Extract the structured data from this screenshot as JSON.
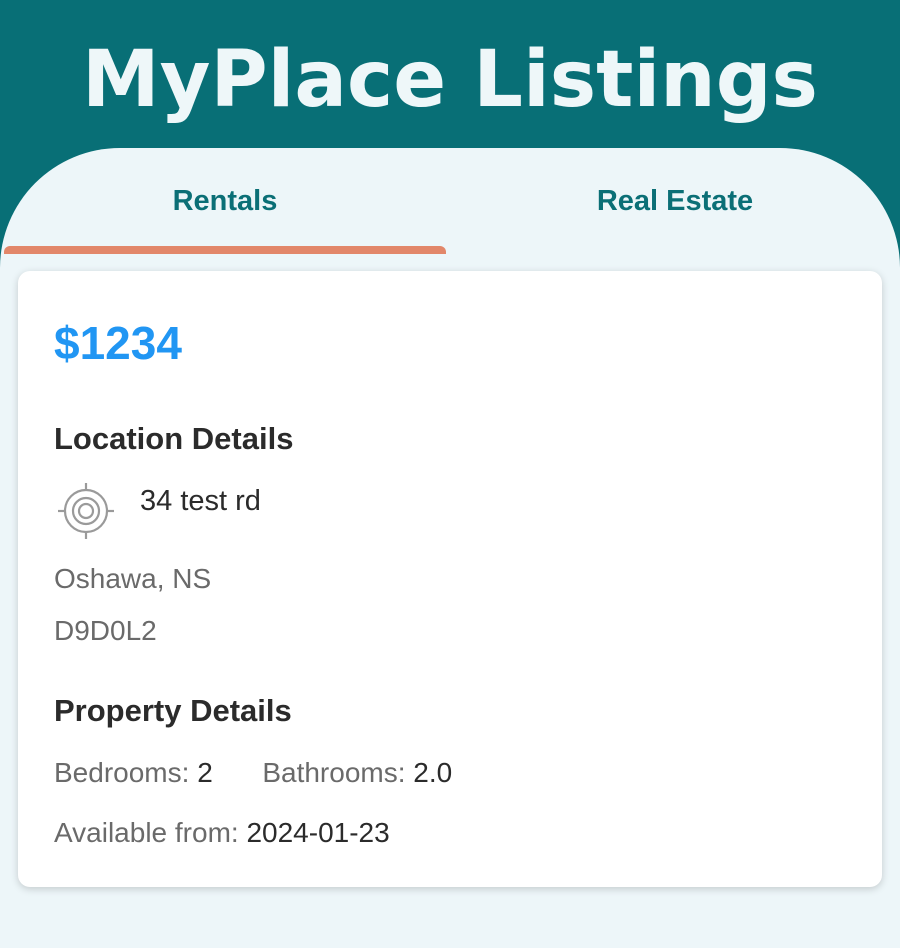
{
  "app": {
    "title": "MyPlace Listings"
  },
  "tabs": [
    {
      "label": "Rentals",
      "selected": true
    },
    {
      "label": "Real Estate",
      "selected": false
    }
  ],
  "listing": {
    "price": "$1234",
    "location_heading": "Location Details",
    "address": "34 test rd",
    "city_province": "Oshawa, NS",
    "postal_code": "D9D0L2",
    "property_heading": "Property Details",
    "bedrooms_label": "Bedrooms:",
    "bedrooms_value": "2",
    "bathrooms_label": "Bathrooms:",
    "bathrooms_value": "2.0",
    "available_label": "Available from:",
    "available_value": "2024-01-23",
    "location_icon": "location-target-icon"
  },
  "colors": {
    "header_bg": "#086f76",
    "title_text": "#eef7f9",
    "tab_text": "#0b6f76",
    "tab_indicator": "#e2876a",
    "price_text": "#2196f3",
    "sheet_bg": "#edf6f9"
  }
}
